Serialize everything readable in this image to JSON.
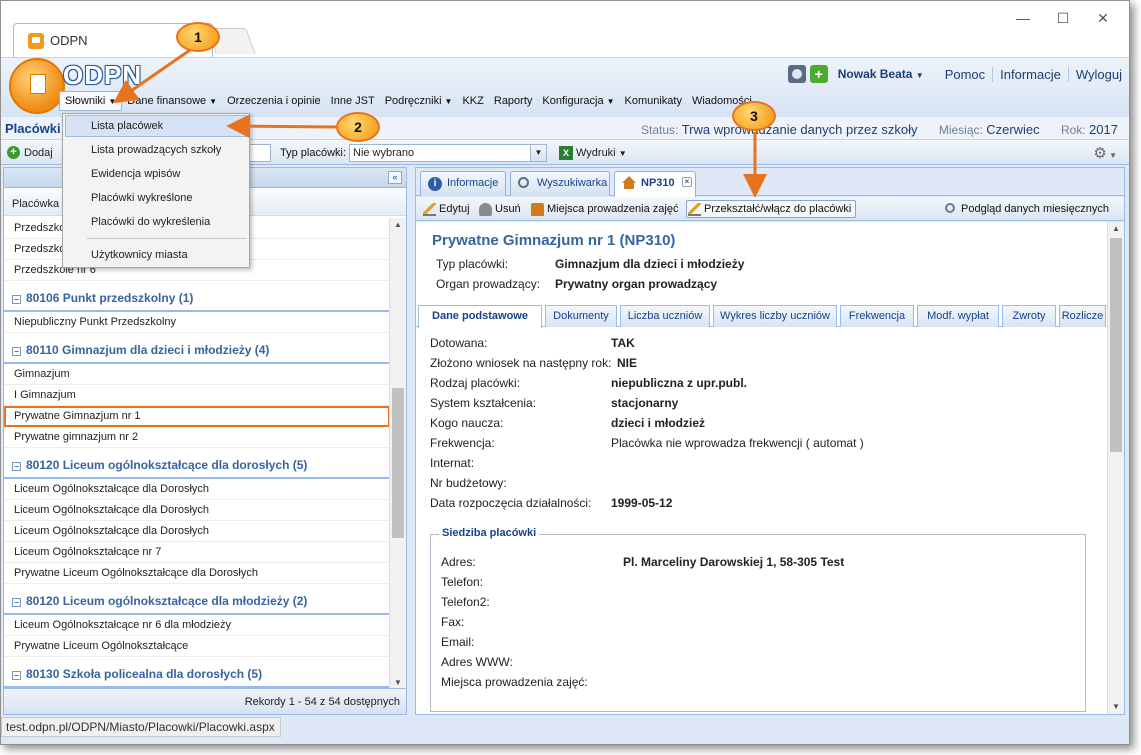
{
  "browser": {
    "tab_title": "ODPN",
    "url": "test.odpn.pl/ODPN/Miasto/Placowki/Placowki.aspx",
    "minimize": "—",
    "maximize": "☐",
    "close": "✕"
  },
  "app": {
    "logo_text": "ODPN",
    "user_name": "Nowak Beata",
    "links": [
      "Pomoc",
      "Informacje",
      "Wyloguj"
    ]
  },
  "menu": {
    "items": [
      "Słowniki",
      "Dane finansowe",
      "Orzeczenia i opinie",
      "Inne JST",
      "Podręczniki",
      "KKZ",
      "Raporty",
      "Konfiguracja",
      "Komunikaty",
      "Wiadomości"
    ]
  },
  "dropdown": {
    "items": [
      "Lista placówek",
      "Lista prowadzących szkoły",
      "Ewidencja wpisów",
      "Placówki wykreślone",
      "Placówki do wykreślenia",
      "Użytkownicy miasta"
    ]
  },
  "status": {
    "page_title": "Placówki",
    "status_label": "Status:",
    "status_value": "Trwa wprowadzanie danych przez szkoły",
    "month_label": "Miesiąc:",
    "month_value": "Czerwiec",
    "year_label": "Rok:",
    "year_value": "2017"
  },
  "toolbar": {
    "add_label": "Dodaj",
    "type_label": "Typ placówki:",
    "type_value": "Nie wybrano",
    "print_label": "Wydruki"
  },
  "left_panel": {
    "column_header": "Placówka",
    "rows": [
      {
        "kind": "row",
        "text": "Przedszkole"
      },
      {
        "kind": "row",
        "text": "Przedszkole"
      },
      {
        "kind": "row",
        "text": "Przedszkole nr 6"
      },
      {
        "kind": "group",
        "text": "80106 Punkt przedszkolny (1)"
      },
      {
        "kind": "row",
        "text": "Niepubliczny Punkt Przedszkolny"
      },
      {
        "kind": "group",
        "text": "80110 Gimnazjum dla dzieci i młodzieży (4)"
      },
      {
        "kind": "row",
        "text": "Gimnazjum"
      },
      {
        "kind": "row",
        "text": "I Gimnazjum"
      },
      {
        "kind": "row",
        "text": "Prywatne Gimnazjum nr 1",
        "selected": true
      },
      {
        "kind": "row",
        "text": "Prywatne gimnazjum nr 2"
      },
      {
        "kind": "group",
        "text": "80120 Liceum ogólnokształcące dla dorosłych (5)"
      },
      {
        "kind": "row",
        "text": "Liceum Ogólnokształcące dla Dorosłych"
      },
      {
        "kind": "row",
        "text": "Liceum Ogólnokształcące dla Dorosłych"
      },
      {
        "kind": "row",
        "text": "Liceum Ogólnokształcące dla Dorosłych"
      },
      {
        "kind": "row",
        "text": "Liceum Ogólnokształcące nr 7"
      },
      {
        "kind": "row",
        "text": "Prywatne Liceum Ogólnokształcące dla Dorosłych"
      },
      {
        "kind": "group",
        "text": "80120 Liceum ogólnokształcące dla młodzieży (2)"
      },
      {
        "kind": "row",
        "text": "Liceum Ogólnokształcące nr 6 dla młodzieży"
      },
      {
        "kind": "row",
        "text": "Prywatne Liceum Ogólnokształcące"
      },
      {
        "kind": "group",
        "text": "80130 Szkoła policealna dla dorosłych (5)"
      }
    ],
    "footer": "Rekordy 1 - 54 z 54 dostępnych"
  },
  "right_panel": {
    "tabs": [
      "Informacje",
      "Wyszukiwarka",
      "NP310"
    ],
    "actions": [
      "Edytuj",
      "Usuń",
      "Miejsca prowadzenia zajęć",
      "Przekształć/włącz do placówki",
      "Podgląd danych miesięcznych"
    ],
    "title": "Prywatne Gimnazjum nr 1 (NP310)",
    "type_label": "Typ placówki:",
    "type_value": "Gimnazjum dla dzieci i młodzieży",
    "organ_label": "Organ prowadzący:",
    "organ_value": "Prywatny organ prowadzący",
    "subtabs": [
      "Dane podstawowe",
      "Dokumenty",
      "Liczba uczniów",
      "Wykres liczby uczniów",
      "Frekwencja",
      "Modf. wypłat",
      "Zwroty",
      "Rozlicze"
    ],
    "details": [
      {
        "label": "Dotowana:",
        "value": "TAK"
      },
      {
        "label": "Złożono wniosek na następny rok:",
        "value": "NIE"
      },
      {
        "label": "Rodzaj placówki:",
        "value": "niepubliczna z upr.publ."
      },
      {
        "label": "System kształcenia:",
        "value": "stacjonarny"
      },
      {
        "label": "Kogo naucza:",
        "value": "dzieci i młodzież"
      },
      {
        "label": "Frekwencja:",
        "value": "Placówka nie wprowadza frekwencji ( automat )"
      },
      {
        "label": "Internat:",
        "value": ""
      },
      {
        "label": "Nr budżetowy:",
        "value": ""
      },
      {
        "label": "Data rozpoczęcia działalności:",
        "value": "1999-05-12"
      }
    ],
    "seat": {
      "legend": "Siedziba placówki",
      "fields": [
        {
          "label": "Adres:",
          "value": "Pl. Marceliny Darowskiej 1, 58-305 Test"
        },
        {
          "label": "Telefon:",
          "value": ""
        },
        {
          "label": "Telefon2:",
          "value": ""
        },
        {
          "label": "Fax:",
          "value": ""
        },
        {
          "label": "Email:",
          "value": ""
        },
        {
          "label": "Adres WWW:",
          "value": ""
        },
        {
          "label": "Miejsca prowadzenia zajęć:",
          "value": ""
        }
      ]
    }
  },
  "annotations": [
    "1",
    "2",
    "3"
  ],
  "colors": {
    "accent": "#15428b",
    "highlight": "#e8731f",
    "callout": "#f5a623"
  }
}
